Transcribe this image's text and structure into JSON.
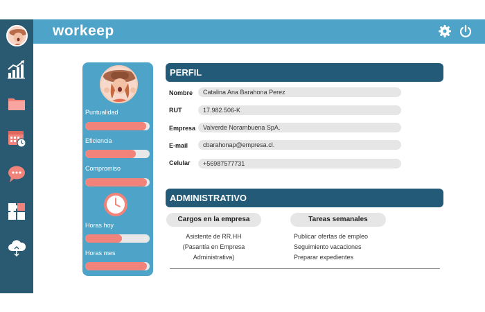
{
  "app": {
    "logo": "workeep"
  },
  "topbar": {
    "settings_icon": "gear-icon",
    "power_icon": "power-icon"
  },
  "sidebar": {
    "icons": [
      "chart-growth-icon",
      "folder-icon",
      "calendar-clock-icon",
      "chat-bubble-icon",
      "puzzle-icon",
      "cloud-icon"
    ]
  },
  "card": {
    "stats": [
      {
        "label": "Puntualidad",
        "value": 0.95
      },
      {
        "label": "Eficiencia",
        "value": 0.78
      },
      {
        "label": "Compromiso",
        "value": 0.96
      },
      {
        "label": "Horas hoy",
        "value": 0.57
      },
      {
        "label": "Horas mes",
        "value": 0.96
      }
    ],
    "clock_icon": "clock-icon"
  },
  "perfil": {
    "title": "PERFIL",
    "fields": [
      {
        "label": "Nombre",
        "value": "Catalina Ana Barahona Perez"
      },
      {
        "label": "RUT",
        "value": "17.982.506-K"
      },
      {
        "label": "Empresa",
        "value": "Valverde Norambuena SpA."
      },
      {
        "label": "E-mail",
        "value": "cbarahonap@empresa.cl."
      },
      {
        "label": "Celular",
        "value": "+56987577731"
      }
    ]
  },
  "administrativo": {
    "title": "ADMINISTRATIVO",
    "cargos_title": "Cargos en la empresa",
    "cargos": [
      "Asistente de RR.HH",
      "(Pasantía en Empresa",
      "Administrativa)"
    ],
    "tareas_title": "Tareas semanales",
    "tareas": [
      "Publicar ofertas de empleo",
      "Seguimiento vacaciones",
      "Preparar expedientes"
    ]
  },
  "colors": {
    "accent": "#4da3c8",
    "dark": "#225a78",
    "bar": "#f2837a"
  }
}
